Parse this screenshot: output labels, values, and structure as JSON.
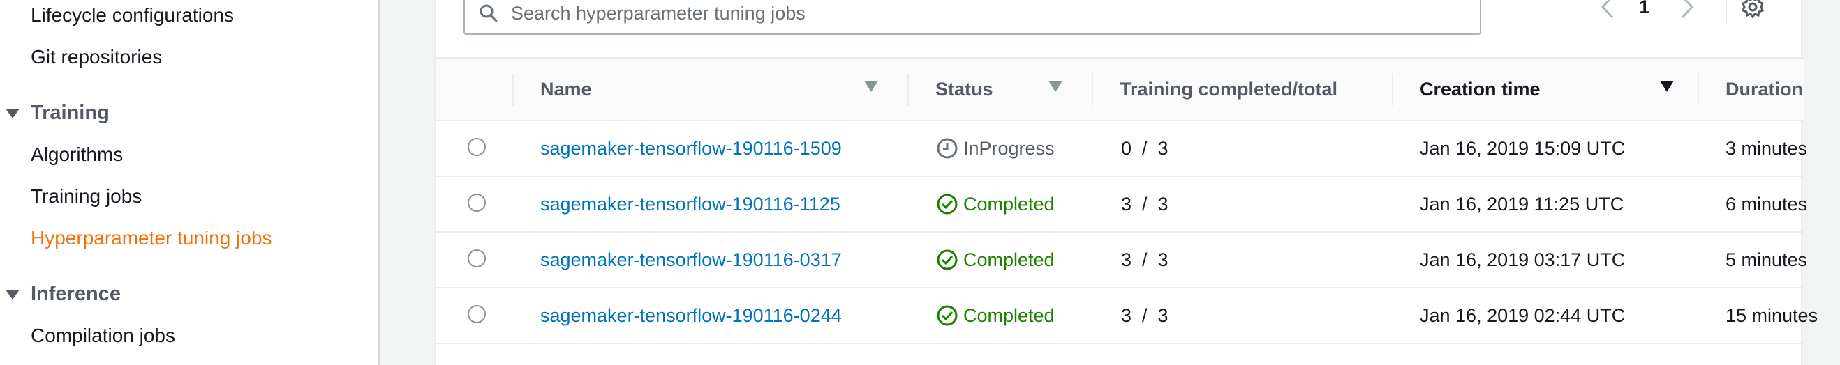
{
  "sidebar": {
    "items_top": [
      {
        "label": "Lifecycle configurations"
      },
      {
        "label": "Git repositories"
      }
    ],
    "training_section": {
      "label": "Training",
      "items": [
        {
          "label": "Algorithms"
        },
        {
          "label": "Training jobs"
        },
        {
          "label": "Hyperparameter tuning jobs",
          "active": true
        }
      ]
    },
    "inference_section": {
      "label": "Inference",
      "items": [
        {
          "label": "Compilation jobs"
        }
      ]
    }
  },
  "search": {
    "placeholder": "Search hyperparameter tuning jobs",
    "icon": "search-icon"
  },
  "pagination": {
    "current_page": "1"
  },
  "table": {
    "columns": {
      "name": "Name",
      "status": "Status",
      "training": "Training completed/total",
      "creation": "Creation time",
      "duration": "Duration"
    },
    "rows": [
      {
        "name": "sagemaker-tensorflow-190116-1509",
        "status": "InProgress",
        "status_type": "in-progress",
        "training": "0  /  3",
        "creation": "Jan 16, 2019 15:09 UTC",
        "duration": "3 minutes"
      },
      {
        "name": "sagemaker-tensorflow-190116-1125",
        "status": "Completed",
        "status_type": "completed",
        "training": "3  /  3",
        "creation": "Jan 16, 2019 11:25 UTC",
        "duration": "6 minutes"
      },
      {
        "name": "sagemaker-tensorflow-190116-0317",
        "status": "Completed",
        "status_type": "completed",
        "training": "3  /  3",
        "creation": "Jan 16, 2019 03:17 UTC",
        "duration": "5 minutes"
      },
      {
        "name": "sagemaker-tensorflow-190116-0244",
        "status": "Completed",
        "status_type": "completed",
        "training": "3  /  3",
        "creation": "Jan 16, 2019 02:44 UTC",
        "duration": "15 minutes"
      }
    ]
  },
  "colors": {
    "link": "#0073bb",
    "active_nav": "#ec7211",
    "completed": "#1d8102",
    "in_progress": "#545b64"
  }
}
